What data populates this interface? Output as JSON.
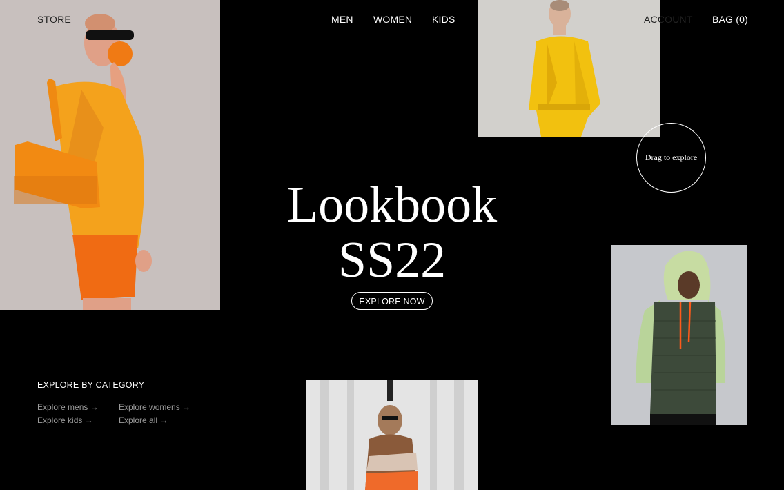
{
  "nav": {
    "store": "STORE",
    "men": "MEN",
    "women": "WOMEN",
    "kids": "KIDS",
    "account": "ACCOUNT",
    "bag": "BAG (0)"
  },
  "hero": {
    "title_line1": "Lookbook",
    "title_line2": "SS22",
    "cta": "EXPLORE NOW"
  },
  "drag": {
    "label": "Drag to explore"
  },
  "category": {
    "heading": "EXPLORE BY CATEGORY",
    "links": [
      "Explore mens →",
      "Explore womens →",
      "Explore kids →",
      "Explore all →"
    ]
  },
  "colors": {
    "background": "#000000",
    "text": "#ffffff",
    "muted_link": "#9a9a9a",
    "accent_orange": "#f39a1e",
    "accent_yellow": "#f5c518"
  }
}
